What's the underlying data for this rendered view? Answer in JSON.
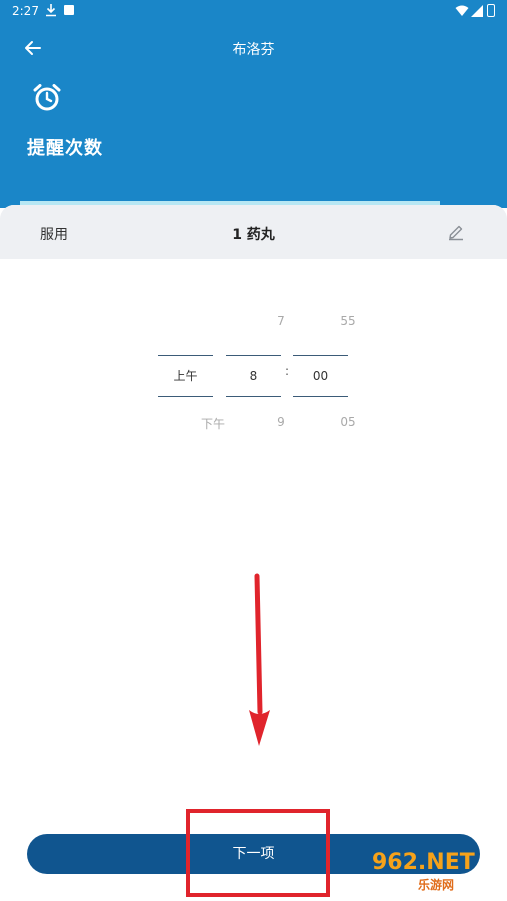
{
  "status_bar": {
    "time": "2:27"
  },
  "header": {
    "title": "布洛芬",
    "heading": "提醒次数"
  },
  "dose_row": {
    "label": "服用",
    "value": "1 药丸"
  },
  "time_picker": {
    "ampm": {
      "above": "",
      "selected": "上午",
      "below": "下午"
    },
    "hour": {
      "above": "7",
      "selected": "8",
      "below": "9"
    },
    "separator": ":",
    "minute": {
      "above": "55",
      "selected": "00",
      "below": "05"
    }
  },
  "footer": {
    "next_label": "下一项"
  },
  "watermark": {
    "brand": "962.NET",
    "sub": "乐游网"
  },
  "colors": {
    "header": "#1a86c8",
    "button": "#10558f",
    "annotation": "#e0242c"
  }
}
